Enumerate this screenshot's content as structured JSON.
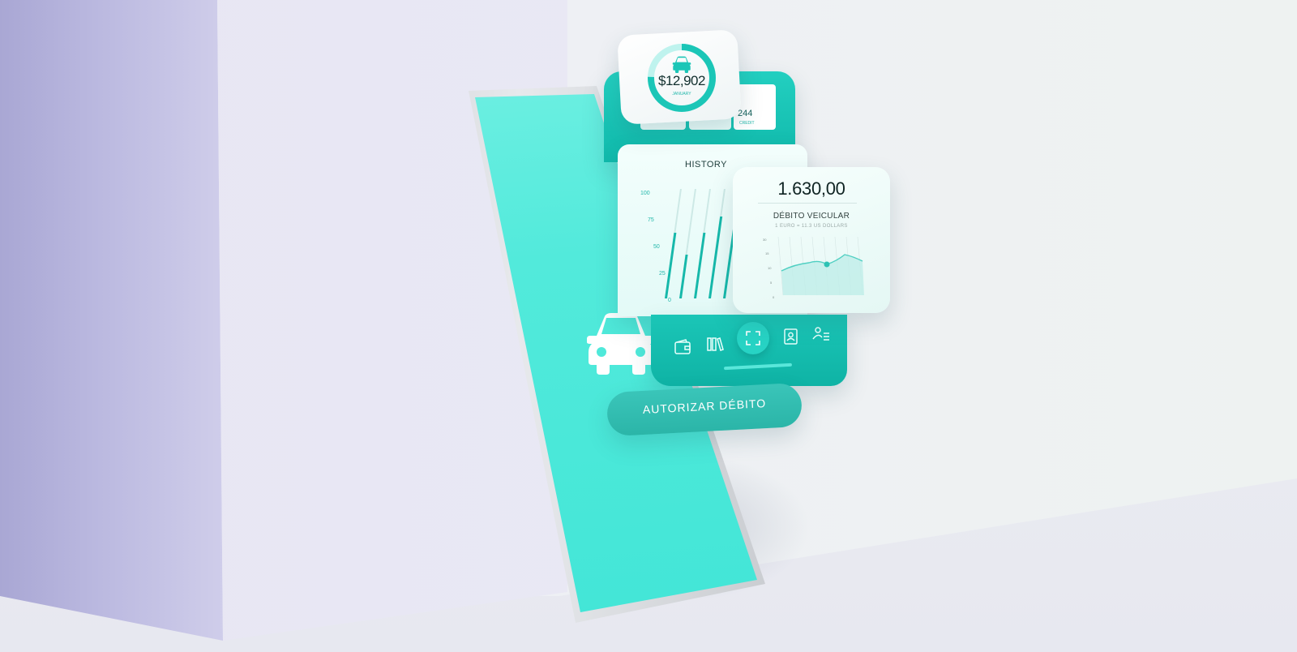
{
  "balance_card": {
    "amount": "$12,902",
    "period": "JANUARY"
  },
  "credit_tile": {
    "amount": "244",
    "label": "CREDIT"
  },
  "history_panel": {
    "title": "HISTORY",
    "y_ticks": [
      "100",
      "75",
      "50",
      "25",
      "0"
    ],
    "bar_levels": [
      0.6,
      0.4,
      0.6,
      0.75,
      0.85
    ]
  },
  "debit_card": {
    "amount": "1.630,00",
    "title": "DÉBITO VEICULAR",
    "subtitle": "1 EURO = 11.3 US DOLLARS",
    "y_ticks": [
      "30",
      "15",
      "10",
      "5",
      "0"
    ]
  },
  "bottom_nav": {
    "icons": [
      "wallet-icon",
      "books-icon",
      "scan-icon",
      "contact-book-icon",
      "profile-list-icon"
    ]
  },
  "cta": {
    "label": "AUTORIZAR DÉBITO"
  },
  "colors": {
    "accent": "#1bc6b7",
    "screen": "#4fe9da",
    "box": "#bbb9e0"
  }
}
